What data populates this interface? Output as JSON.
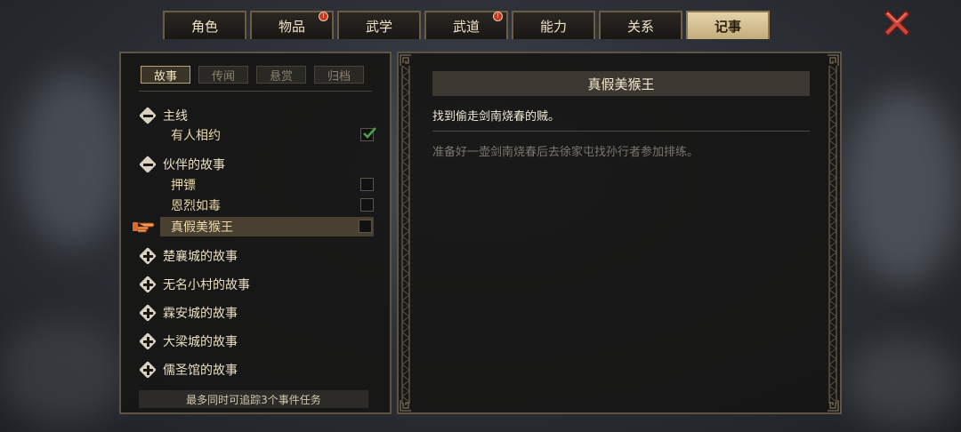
{
  "tabs": [
    {
      "label": "角色",
      "badge": false
    },
    {
      "label": "物品",
      "badge": true
    },
    {
      "label": "武学",
      "badge": false
    },
    {
      "label": "武道",
      "badge": true
    },
    {
      "label": "能力",
      "badge": false
    },
    {
      "label": "关系",
      "badge": false
    },
    {
      "label": "记事",
      "badge": false,
      "active": true
    }
  ],
  "badge_glyph": "!",
  "subtabs": [
    "故事",
    "传闻",
    "悬赏",
    "归档"
  ],
  "active_subtab": "故事",
  "tree": {
    "main": {
      "label": "主线",
      "expanded": true,
      "items": [
        {
          "label": "有人相约",
          "done": true
        }
      ]
    },
    "companion": {
      "label": "伙伴的故事",
      "expanded": true,
      "items": [
        {
          "label": "押镖",
          "done": false
        },
        {
          "label": "恩烈如毒",
          "done": false
        },
        {
          "label": "真假美猴王",
          "done": false,
          "selected": true
        }
      ]
    },
    "collapsed": [
      "楚襄城的故事",
      "无名小村的故事",
      "霖安城的故事",
      "大梁城的故事",
      "儒圣馆的故事"
    ]
  },
  "footer_note": "最多同时可追踪3个事件任务",
  "quest": {
    "title": "真假美猴王",
    "goal": "找到偷走剑南烧春的贼。",
    "description": "准备好一壶剑南烧春后去徐家屯找孙行者参加排练。"
  },
  "colors": {
    "accent": "#c4ad7c",
    "check": "#4aa24a",
    "close": "#c8463a",
    "pointer": "#e0662a"
  }
}
